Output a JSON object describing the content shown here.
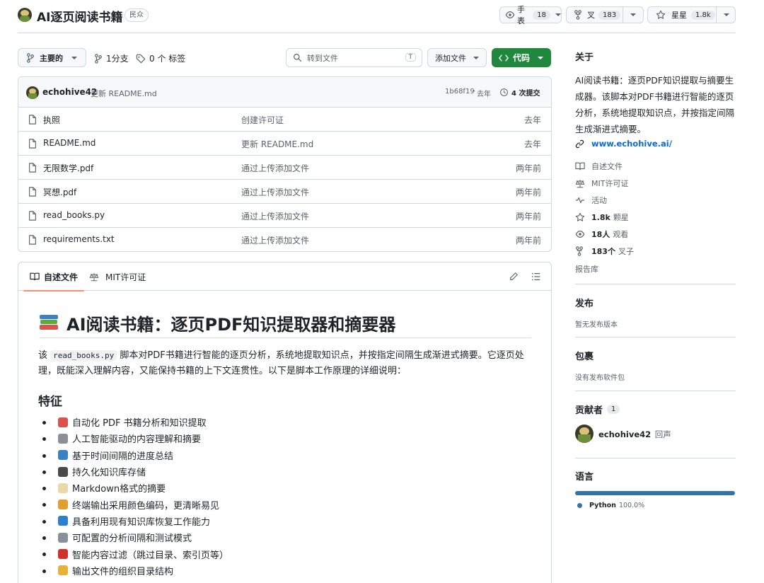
{
  "repo": {
    "name": "AI逐页阅读书籍",
    "visibility": "民众"
  },
  "header_actions": {
    "watch_label": "手表",
    "watch_count": "18",
    "fork_label": "叉",
    "fork_count": "183",
    "star_label": "星星",
    "star_count": "1.8k"
  },
  "toolbar": {
    "branch": "主要的",
    "branches": "1分支",
    "tags": "0 个 标签",
    "search_placeholder": "转到文件",
    "search_shortcut": "T",
    "add_file": "添加文件",
    "code": "代码"
  },
  "commit": {
    "author": "echohive42",
    "message": "更新 README.md",
    "hash": "1b68f19",
    "time": "去年",
    "count": "4 次提交"
  },
  "files": [
    {
      "name": "执照",
      "message": "创建许可证",
      "date": "去年"
    },
    {
      "name": "README.md",
      "message": "更新 README.md",
      "date": "去年"
    },
    {
      "name": "无限数学.pdf",
      "message": "通过上传添加文件",
      "date": "两年前"
    },
    {
      "name": "冥想.pdf",
      "message": "通过上传添加文件",
      "date": "两年前"
    },
    {
      "name": "read_books.py",
      "message": "通过上传添加文件",
      "date": "两年前"
    },
    {
      "name": "requirements.txt",
      "message": "通过上传添加文件",
      "date": "两年前"
    }
  ],
  "readme": {
    "tab_readme": "自述文件",
    "tab_license": "MIT许可证",
    "title": "AI阅读书籍：逐页PDF知识提取器和摘要器",
    "intro_prefix": "该",
    "intro_code": "read_books.py",
    "intro_line1": "脚本对PDF书籍进行智能的逐页分析，系统地提取知识点，并按指定间隔生成渐进式摘要。它逐页处",
    "intro_line2": "理，既能深入理解内容，又能保持书籍的上下文连贯性。以下是脚本工作原理的详细说明：",
    "features_heading": "特征",
    "features": [
      {
        "text": "自动化 PDF 书籍分析和知识提取",
        "icon": "books-icon",
        "color": "#d9534f"
      },
      {
        "text": "人工智能驱动的内容理解和摘要",
        "icon": "robot-icon",
        "color": "#8a8f98"
      },
      {
        "text": "基于时间间隔的进度总结",
        "icon": "bar-chart-icon",
        "color": "#3b82c4"
      },
      {
        "text": "持久化知识库存储",
        "icon": "floppy-icon",
        "color": "#4a4a4a"
      },
      {
        "text": "Markdown格式的摘要",
        "icon": "memo-icon",
        "color": "#e8d9a8"
      },
      {
        "text": "终端输出采用颜色编码，更清晰易见",
        "icon": "palette-icon",
        "color": "#e0a030"
      },
      {
        "text": "具备利用现有知识库恢复工作能力",
        "icon": "refresh-icon",
        "color": "#2f7fd0"
      },
      {
        "text": "可配置的分析间隔和测试模式",
        "icon": "gear-icon",
        "color": "#8a8f98"
      },
      {
        "text": "智能内容过滤（跳过目录、索引页等）",
        "icon": "prohibited-icon",
        "color": "#d0312d"
      },
      {
        "text": "输出文件的组织目录结构",
        "icon": "folder-icon",
        "color": "#e8b23a"
      }
    ]
  },
  "sidebar": {
    "about_heading": "关于",
    "about_text": "AI阅读书籍：逐页PDF知识提取与摘要生成器。该脚本对PDF书籍进行智能的逐页分析，系统地提取知识点，并按指定间隔生成渐进式摘要。",
    "website": "www.echohive.ai/",
    "readme_link": "自述文件",
    "license_link": "MIT许可证",
    "activity_link": "活动",
    "stars_num": "1.8k",
    "stars_label": "颗星",
    "watching_num": "18人",
    "watching_label": "观看",
    "forks_num": "183个",
    "forks_label": "叉子",
    "report": "报告库",
    "releases_heading": "发布",
    "releases_text": "暂无发布版本",
    "packages_heading": "包裹",
    "packages_text": "没有发布软件包",
    "contributors_heading": "贡献者",
    "contributors_count": "1",
    "contributor_name": "echohive42",
    "contributor_extra": "回声",
    "languages_heading": "语言",
    "language_name": "Python",
    "language_percent": "100.0%",
    "language_share": 1.0,
    "language_color": "#3572A5"
  },
  "colors": {
    "accent_green": "#1f883d",
    "link_blue": "#0969da",
    "tab_underline": "#fd8c73"
  }
}
